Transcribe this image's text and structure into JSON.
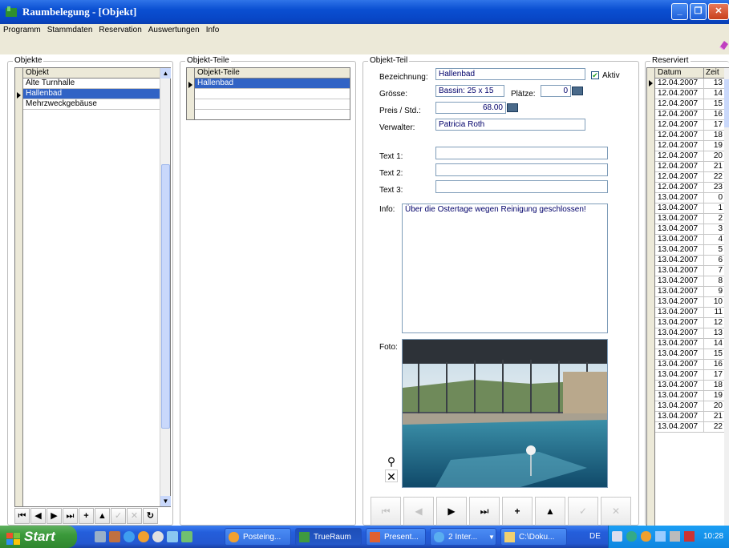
{
  "window": {
    "title": "Raumbelegung - [Objekt]"
  },
  "menu": [
    "Programm",
    "Stammdaten",
    "Reservation",
    "Auswertungen",
    "Info"
  ],
  "objekte": {
    "title": "Objekte",
    "header": "Objekt",
    "rows": [
      "Alte Turnhalle",
      "Hallenbad",
      "Mehrzweckgebäuse"
    ],
    "selected_index": 1
  },
  "objekt_teile": {
    "title": "Objekt-Teile",
    "header": "Objekt-Teile",
    "rows": [
      "Hallenbad"
    ]
  },
  "objekt_teil": {
    "title": "Objekt-Teil",
    "bezeichnung_label": "Bezeichnung:",
    "bezeichnung": "Hallenbad",
    "aktiv_label": "Aktiv",
    "groesse_label": "Grösse:",
    "groesse": "Bassin: 25 x 15",
    "plaetze_label": "Plätze:",
    "plaetze": "0",
    "preis_label": "Preis / Std.:",
    "preis": "68.00",
    "verwalter_label": "Verwalter:",
    "verwalter": "Patricia Roth",
    "text1_label": "Text 1:",
    "text2_label": "Text 2:",
    "text3_label": "Text 3:",
    "info_label": "Info:",
    "info": "Über die Ostertage wegen Reinigung geschlossen!",
    "foto_label": "Foto:"
  },
  "reserviert": {
    "title": "Reserviert",
    "headers": [
      "Datum",
      "Zeit"
    ],
    "rows": [
      [
        "12.04.2007",
        "13"
      ],
      [
        "12.04.2007",
        "14"
      ],
      [
        "12.04.2007",
        "15"
      ],
      [
        "12.04.2007",
        "16"
      ],
      [
        "12.04.2007",
        "17"
      ],
      [
        "12.04.2007",
        "18"
      ],
      [
        "12.04.2007",
        "19"
      ],
      [
        "12.04.2007",
        "20"
      ],
      [
        "12.04.2007",
        "21"
      ],
      [
        "12.04.2007",
        "22"
      ],
      [
        "12.04.2007",
        "23"
      ],
      [
        "13.04.2007",
        "0"
      ],
      [
        "13.04.2007",
        "1"
      ],
      [
        "13.04.2007",
        "2"
      ],
      [
        "13.04.2007",
        "3"
      ],
      [
        "13.04.2007",
        "4"
      ],
      [
        "13.04.2007",
        "5"
      ],
      [
        "13.04.2007",
        "6"
      ],
      [
        "13.04.2007",
        "7"
      ],
      [
        "13.04.2007",
        "8"
      ],
      [
        "13.04.2007",
        "9"
      ],
      [
        "13.04.2007",
        "10"
      ],
      [
        "13.04.2007",
        "11"
      ],
      [
        "13.04.2007",
        "12"
      ],
      [
        "13.04.2007",
        "13"
      ],
      [
        "13.04.2007",
        "14"
      ],
      [
        "13.04.2007",
        "15"
      ],
      [
        "13.04.2007",
        "16"
      ],
      [
        "13.04.2007",
        "17"
      ],
      [
        "13.04.2007",
        "18"
      ],
      [
        "13.04.2007",
        "19"
      ],
      [
        "13.04.2007",
        "20"
      ],
      [
        "13.04.2007",
        "21"
      ],
      [
        "13.04.2007",
        "22"
      ]
    ]
  },
  "taskbar": {
    "start": "Start",
    "tasks": [
      "Posteing...",
      "TrueRaum",
      "Present...",
      "2 Inter...",
      "C:\\Doku..."
    ],
    "lang": "DE",
    "clock": "10:28"
  }
}
